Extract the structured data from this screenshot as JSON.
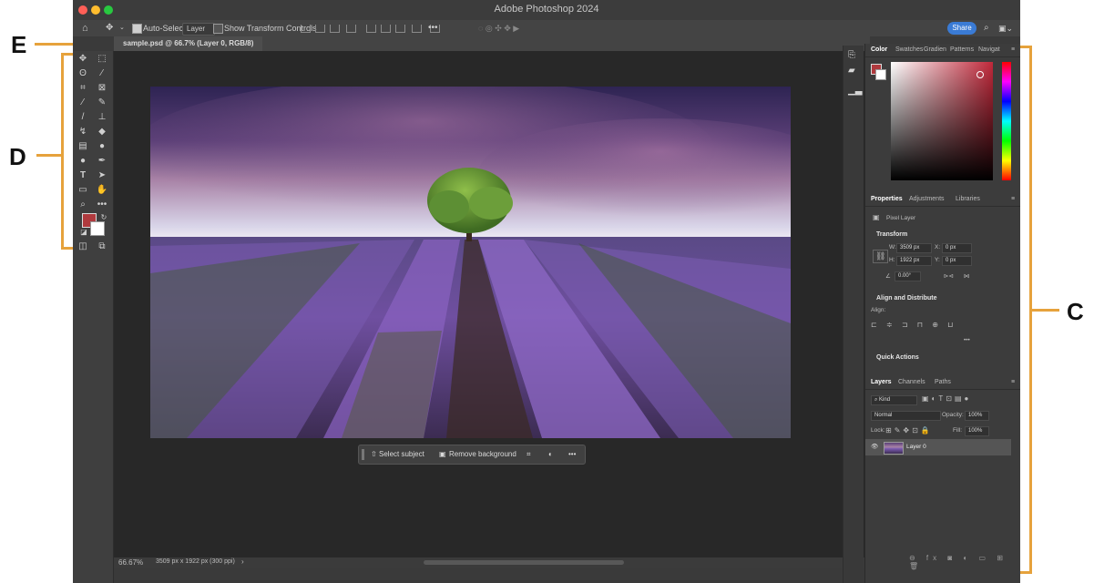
{
  "app_title": "Adobe Photoshop 2024",
  "options_bar": {
    "auto_select_label": "Auto-Select:",
    "auto_select_value": "Layer",
    "transform_controls_label": "Show Transform Controls",
    "share_label": "Share"
  },
  "document": {
    "tab_title": "sample.psd @ 66.7% (Layer 0, RGB/8)"
  },
  "contextual_taskbar": {
    "select_subject": "Select subject",
    "remove_background": "Remove background"
  },
  "status_bar": {
    "zoom": "66.67%",
    "doc_info": "3509 px x 1922 px (300 ppi)"
  },
  "color_panel": {
    "tabs": [
      "Color",
      "Swatches",
      "Gradien",
      "Patterns",
      "Navigat"
    ],
    "foreground_color": "#b03a3e",
    "background_color": "#ffffff"
  },
  "properties_panel": {
    "tabs": [
      "Properties",
      "Adjustments",
      "Libraries"
    ],
    "layer_type": "Pixel Layer",
    "transform_heading": "Transform",
    "w_label": "W:",
    "w_value": "3509 px",
    "h_label": "H:",
    "h_value": "1922 px",
    "x_label": "X:",
    "x_value": "0 px",
    "y_label": "Y:",
    "y_value": "0 px",
    "angle_value": "0.00°",
    "align_heading": "Align and Distribute",
    "align_label": "Align:",
    "quick_actions_heading": "Quick Actions"
  },
  "layers_panel": {
    "tabs": [
      "Layers",
      "Channels",
      "Paths"
    ],
    "filter_kind": "Kind",
    "blend_mode": "Normal",
    "opacity_label": "Opacity:",
    "opacity_value": "100%",
    "lock_label": "Lock:",
    "fill_label": "Fill:",
    "fill_value": "100%",
    "layers": [
      {
        "name": "Layer 0",
        "visible": true
      }
    ]
  },
  "annotations": {
    "labels": [
      "E",
      "D",
      "C"
    ],
    "accent_color": "#e6a23c"
  }
}
